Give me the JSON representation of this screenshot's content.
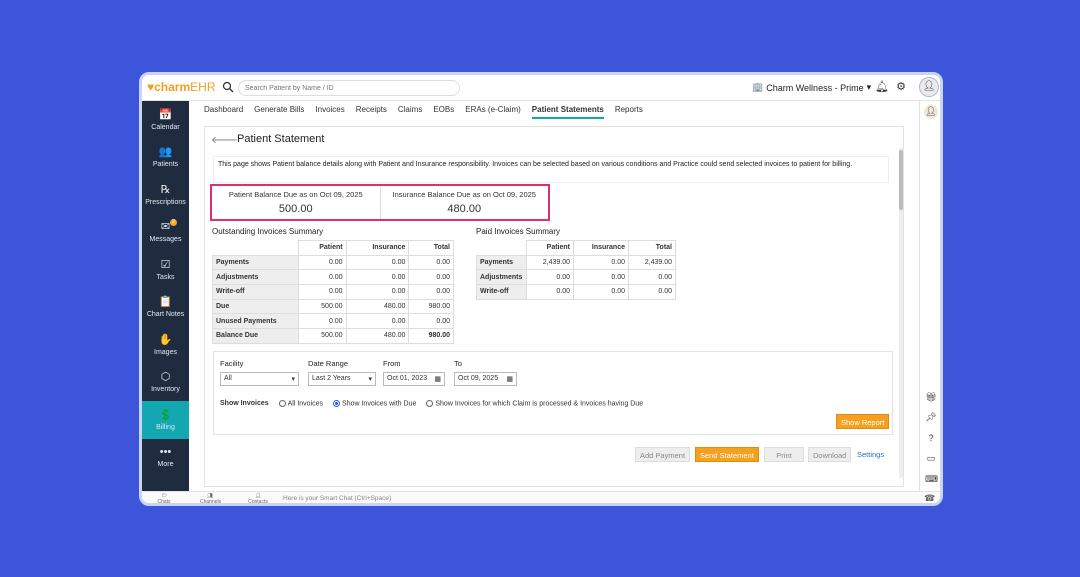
{
  "app": {
    "logo_text": "charm",
    "logo_suffix": "EHR",
    "search_placeholder": "Search Patient by Name / ID",
    "practice_name": "Charm Wellness - Prime"
  },
  "sidebar": {
    "items": [
      {
        "label": "Calendar",
        "icon": "calendar-icon",
        "glyph": "📅"
      },
      {
        "label": "Patients",
        "icon": "patients-icon",
        "glyph": "👥"
      },
      {
        "label": "Prescriptions",
        "icon": "prescription-icon",
        "glyph": "℞"
      },
      {
        "label": "Messages",
        "icon": "mail-icon",
        "glyph": "✉",
        "badge": "2"
      },
      {
        "label": "Tasks",
        "icon": "tasks-icon",
        "glyph": "☑"
      },
      {
        "label": "Chart Notes",
        "icon": "chart-notes-icon",
        "glyph": "📋"
      },
      {
        "label": "Images",
        "icon": "images-icon",
        "glyph": "✋"
      },
      {
        "label": "Inventory",
        "icon": "inventory-icon",
        "glyph": "⬡"
      },
      {
        "label": "Billing",
        "icon": "billing-icon",
        "glyph": "💲"
      },
      {
        "label": "More",
        "icon": "more-icon",
        "glyph": "•••"
      }
    ]
  },
  "tabs": [
    "Dashboard",
    "Generate Bills",
    "Invoices",
    "Receipts",
    "Claims",
    "EOBs",
    "ERAs (e-Claim)",
    "Patient Statements",
    "Reports"
  ],
  "page": {
    "title": "Patient Statement",
    "info": "This page shows Patient balance details along with Patient and Insurance responsibility. Invoices can be selected based on various conditions and Practice could send selected invoices to patient for billing.",
    "patient_balance_label": "Patient Balance Due as on Oct 09, 2025",
    "patient_balance_value": "500.00",
    "insurance_balance_label": "Insurance Balance Due as on Oct 09, 2025",
    "insurance_balance_value": "480.00"
  },
  "outstanding": {
    "title": "Outstanding Invoices Summary",
    "headers": [
      "Patient",
      "Insurance",
      "Total"
    ],
    "rows": [
      {
        "label": "Payments",
        "values": [
          "0.00",
          "0.00",
          "0.00"
        ]
      },
      {
        "label": "Adjustments",
        "values": [
          "0.00",
          "0.00",
          "0.00"
        ]
      },
      {
        "label": "Write-off",
        "values": [
          "0.00",
          "0.00",
          "0.00"
        ]
      },
      {
        "label": "Due",
        "values": [
          "500.00",
          "480.00",
          "980.00"
        ]
      },
      {
        "label": "Unused Payments",
        "values": [
          "0.00",
          "0.00",
          "0.00"
        ]
      },
      {
        "label": "Balance Due",
        "values": [
          "500.00",
          "480.00",
          "980.00"
        ]
      }
    ]
  },
  "paid": {
    "title": "Paid Invoices Summary",
    "headers": [
      "Patient",
      "Insurance",
      "Total"
    ],
    "rows": [
      {
        "label": "Payments",
        "values": [
          "2,439.00",
          "0.00",
          "2,439.00"
        ]
      },
      {
        "label": "Adjustments",
        "values": [
          "0.00",
          "0.00",
          "0.00"
        ]
      },
      {
        "label": "Write-off",
        "values": [
          "0.00",
          "0.00",
          "0.00"
        ]
      }
    ]
  },
  "filters": {
    "facility_label": "Facility",
    "facility_value": "All",
    "date_range_label": "Date Range",
    "date_range_value": "Last 2 Years",
    "from_label": "From",
    "from_value": "Oct 01, 2023",
    "to_label": "To",
    "to_value": "Oct 09, 2025",
    "show_invoices_label": "Show Invoices",
    "options": [
      "All Invoices",
      "Show Invoices with Due",
      "Show Invoices for which Claim is processed & Invoices having Due"
    ],
    "selected_option": "Show Invoices with Due",
    "show_report": "Show Report"
  },
  "actions": {
    "add_payment": "Add Payment",
    "send_statement": "Send Statement",
    "print": "Print",
    "download": "Download",
    "settings": "Settings"
  },
  "bottombar": {
    "chats": "Chats",
    "channels": "Channels",
    "contacts": "Contacts",
    "smart_chat": "Here is your Smart Chat (Ctrl+Space)"
  },
  "colors": {
    "accent": "#13a7b2",
    "sidebar": "#1f2c3f",
    "orange": "#f5a01e",
    "highlight": "#e0306c",
    "background": "#3d55d8"
  }
}
